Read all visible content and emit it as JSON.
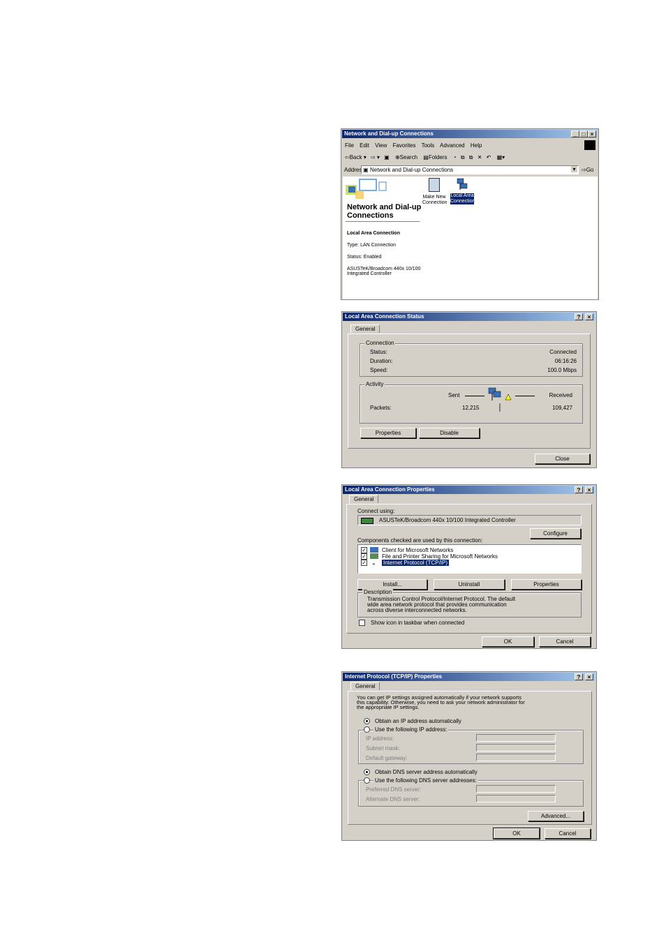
{
  "explorer": {
    "title": "Network and Dial-up Connections",
    "menu": [
      "File",
      "Edit",
      "View",
      "Favorites",
      "Tools",
      "Advanced",
      "Help"
    ],
    "toolbar": {
      "back": "Back",
      "search": "Search",
      "folders": "Folders"
    },
    "address_label": "Address",
    "address_value": "Network and Dial-up Connections",
    "go": "Go",
    "heading_line1": "Network and Dial-up",
    "heading_line2": "Connections",
    "icons": [
      {
        "line1": "Make New",
        "line2": "Connection"
      },
      {
        "line1": "Local Area",
        "line2": "Connection"
      }
    ],
    "details": {
      "name": "Local Area Connection",
      "type": "Type: LAN Connection",
      "status": "Status: Enabled",
      "adapter_line1": "ASUSTeK/Broadcom 440x 10/100",
      "adapter_line2": "Integrated Controller"
    }
  },
  "status_dialog": {
    "title": "Local Area Connection Status",
    "tab": "General",
    "connection_group": "Connection",
    "rows": [
      {
        "label": "Status:",
        "value": "Connected"
      },
      {
        "label": "Duration:",
        "value": "06:16:26"
      },
      {
        "label": "Speed:",
        "value": "100.0 Mbps"
      }
    ],
    "activity_group": "Activity",
    "sent": "Sent",
    "received": "Received",
    "packets_label": "Packets:",
    "packets_sent": "12,215",
    "packets_received": "109,427",
    "properties_btn": "Properties",
    "disable_btn": "Disable",
    "close_btn": "Close"
  },
  "props_dialog": {
    "title": "Local Area Connection Properties",
    "tab": "General",
    "connect_using": "Connect using:",
    "adapter": "ASUSTeK/Broadcom 440x 10/100 Integrated Controller",
    "configure_btn": "Configure",
    "components_label": "Components checked are used by this connection:",
    "components": [
      "Client for Microsoft Networks",
      "File and Printer Sharing for Microsoft Networks",
      "Internet Protocol (TCP/IP)"
    ],
    "install_btn": "Install...",
    "uninstall_btn": "Uninstall",
    "properties_btn": "Properties",
    "description_group": "Description",
    "description_lines": [
      "Transmission Control Protocol/Internet Protocol. The default",
      "wide area network protocol that provides communication",
      "across diverse interconnected networks."
    ],
    "show_icon": "Show icon in taskbar when connected",
    "ok_btn": "OK",
    "cancel_btn": "Cancel"
  },
  "tcp_dialog": {
    "title": "Internet Protocol (TCP/IP) Properties",
    "tab": "General",
    "intro_lines": [
      "You can get IP settings assigned automatically if your network supports",
      "this capability. Otherwise, you need to ask your network administrator for",
      "the appropriate IP settings."
    ],
    "obtain_ip": "Obtain an IP address automatically",
    "use_ip": "Use the following IP address:",
    "ip_address": "IP address:",
    "subnet_mask": "Subnet mask:",
    "default_gateway": "Default gateway:",
    "obtain_dns": "Obtain DNS server address automatically",
    "use_dns": "Use the following DNS server addresses:",
    "preferred_dns": "Preferred DNS server:",
    "alternate_dns": "Alternate DNS server:",
    "advanced_btn": "Advanced...",
    "ok_btn": "OK",
    "cancel_btn": "Cancel"
  }
}
